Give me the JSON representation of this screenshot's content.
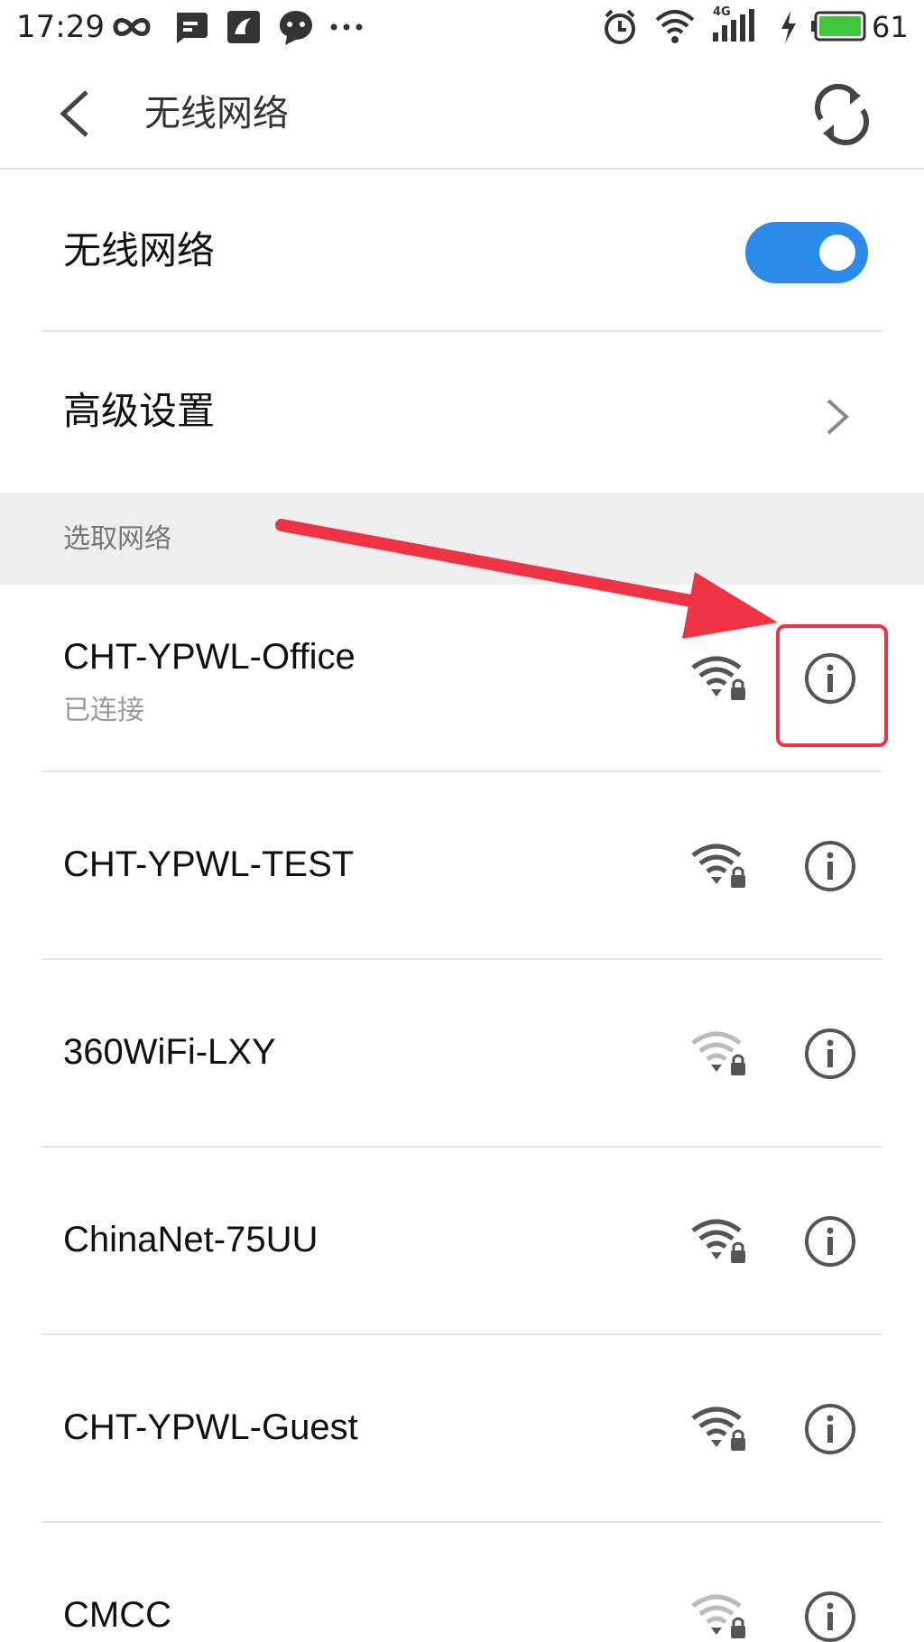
{
  "status_bar": {
    "time": "17:29",
    "network_label": "4G",
    "battery_percent": "61",
    "icons": [
      "infinity-icon",
      "chat-bubble-icon",
      "uc-browser-icon",
      "message-icon",
      "more-dots-icon",
      "alarm-icon",
      "wifi-icon",
      "cell-signal-icon",
      "charging-icon",
      "battery-icon"
    ]
  },
  "app_bar": {
    "title": "无线网络"
  },
  "settings": {
    "wifi_toggle_label": "无线网络",
    "wifi_enabled": true,
    "advanced_label": "高级设置"
  },
  "section": {
    "choose_network_label": "选取网络"
  },
  "networks": [
    {
      "name": "CHT-YPWL-Office",
      "status": "已连接",
      "signal": "strong",
      "locked": true
    },
    {
      "name": "CHT-YPWL-TEST",
      "status": "",
      "signal": "strong",
      "locked": true
    },
    {
      "name": "360WiFi-LXY",
      "status": "",
      "signal": "weak",
      "locked": true
    },
    {
      "name": "ChinaNet-75UU",
      "status": "",
      "signal": "strong",
      "locked": true
    },
    {
      "name": "CHT-YPWL-Guest",
      "status": "",
      "signal": "strong",
      "locked": true
    },
    {
      "name": "CMCC",
      "status": "",
      "signal": "weak",
      "locked": true
    }
  ],
  "colors": {
    "toggle_on": "#2b8be8",
    "annotation_red": "#ee3344",
    "icon_dark": "#555555",
    "icon_weak": "#bbbbbb"
  }
}
